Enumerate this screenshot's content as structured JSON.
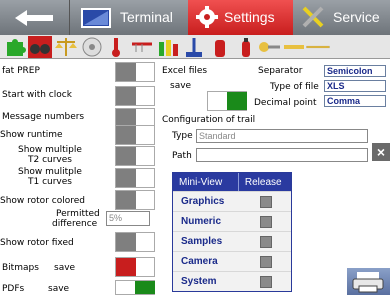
{
  "topbar": {
    "terminal_label": "Terminal",
    "settings_label": "Settings",
    "service_label": "Service"
  },
  "left": {
    "fat_prep": "fat PREP",
    "start_with_clock": "Start with clock",
    "message_numbers": "Message numbers",
    "show_runtime": "Show runtime",
    "show_multiple_t2": "Show multiple\nT2 curves",
    "show_multiple_t2_line1": "Show multiple",
    "show_multiple_t2_line2": "T2 curves",
    "show_multiple_t1_line1": "Show mulitple",
    "show_multiple_t1_line2": "T1 curves",
    "show_rotor_colored": "Show rotor colored",
    "permitted_line1": "Permitted",
    "permitted_line2": "difference",
    "permitted_value": "5%",
    "show_rotor_fixed": "Show rotor fixed",
    "bitmaps": "Bitmaps",
    "bitmaps_save": "save",
    "pdfs": "PDFs",
    "pdfs_save": "save"
  },
  "excel": {
    "title": "Excel files",
    "save": "save",
    "separator_label": "Separator",
    "separator_value": "Semicolon",
    "type_label": "Type of file",
    "type_value": "XLS",
    "decimal_label": "Decimal point",
    "decimal_value": "Comma"
  },
  "trail": {
    "title": "Configuration of trail",
    "type_label": "Type",
    "type_placeholder": "Standard",
    "path_label": "Path",
    "path_value": ""
  },
  "miniview": {
    "col1": "Mini-View",
    "col2": "Release",
    "rows": [
      "Graphics",
      "Numeric",
      "Samples",
      "Camera",
      "System"
    ]
  },
  "colors": {
    "settings_tab": "#d42828",
    "toggle_on": "#1a8a1a",
    "toggle_red": "#c81e1e",
    "table_header": "#2a3aa0"
  }
}
